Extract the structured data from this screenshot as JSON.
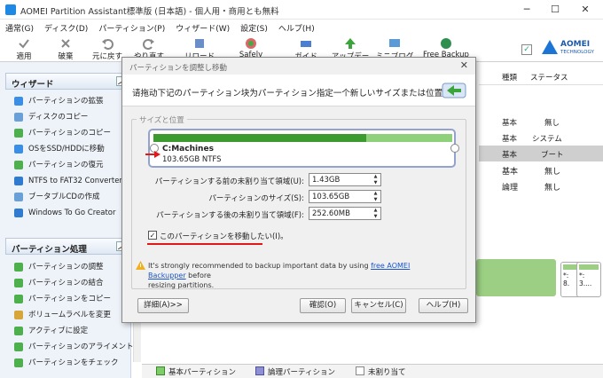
{
  "window": {
    "title": "AOMEI Partition Assistant標準版 (日本語) - 個人用・商用とも無料"
  },
  "menu": [
    "通常(G)",
    "ディスク(D)",
    "パーティション(P)",
    "ウィザード(W)",
    "設定(S)",
    "ヘルプ(H)"
  ],
  "toolbar": {
    "apply": "適用",
    "discard": "破棄",
    "undo": "元に戻す",
    "redo": "やり直す",
    "reload": "リロード",
    "safely_partition": "Safely Partition",
    "guide": "ガイド",
    "update": "アップデート",
    "mini_blog": "ミニブログ",
    "free_backup": "Free Backup",
    "logo_line1": "AOMEI",
    "logo_line2": "TECHNOLOGY"
  },
  "wizard_panel": {
    "title": "ウィザード",
    "items": [
      "パーティションの拡張",
      "ディスクのコピー",
      "パーティションのコピー",
      "OSをSSD/HDDに移動",
      "パーティションの復元",
      "NTFS to FAT32 Converter",
      "ブータブルCDの作成",
      "Windows To Go Creator"
    ]
  },
  "partition_panel": {
    "title": "パーティション処理",
    "items": [
      "パーティションの調整",
      "パーティションの結合",
      "パーティションをコピー",
      "ボリュームラベルを変更",
      "アクティブに設定",
      "パーティションのアライメント",
      "パーティションをチェック"
    ]
  },
  "table": {
    "headers": [
      "種類",
      "ステータス"
    ],
    "rows": [
      [
        "基本",
        "無し"
      ],
      [
        "基本",
        "システム"
      ],
      [
        "基本",
        "ブート"
      ],
      [
        "基本",
        "無し"
      ],
      [
        "論理",
        "無し"
      ]
    ]
  },
  "disk_cards": [
    [
      "*:",
      "8."
    ],
    [
      "*:",
      "3...."
    ]
  ],
  "legend": {
    "primary": "基本パーティション",
    "logical": "論理パーティション",
    "unallocated": "未割り当て"
  },
  "dialog": {
    "title": "パーティションを調整し移動",
    "message": "请拖动下记のパーティション块为パーティション指定一个新しいサイズまたは位置。",
    "group_label": "サイズと位置",
    "partition_name": "C:Machines",
    "partition_info": "103.65GB NTFS",
    "fields": {
      "before_label": "パーティションする前の未割り当て領域(U):",
      "before_value": "1.43GB",
      "size_label": "パーティションのサイズ(S):",
      "size_value": "103.65GB",
      "after_label": "パーティションする後の未割り当て領域(F):",
      "after_value": "252.60MB"
    },
    "move_checkbox": "このパーティションを移動したい(I)。",
    "move_checked": true,
    "warning_pre": "It's strongly recommended to backup important data by using ",
    "warning_link": "free AOMEI Backupper",
    "warning_post": " before",
    "warning_line2": "resizing partitions.",
    "buttons": {
      "details": "詳細(A)>>",
      "ok": "確認(O)",
      "cancel": "キャンセル(C)",
      "help": "ヘルプ(H)"
    }
  }
}
